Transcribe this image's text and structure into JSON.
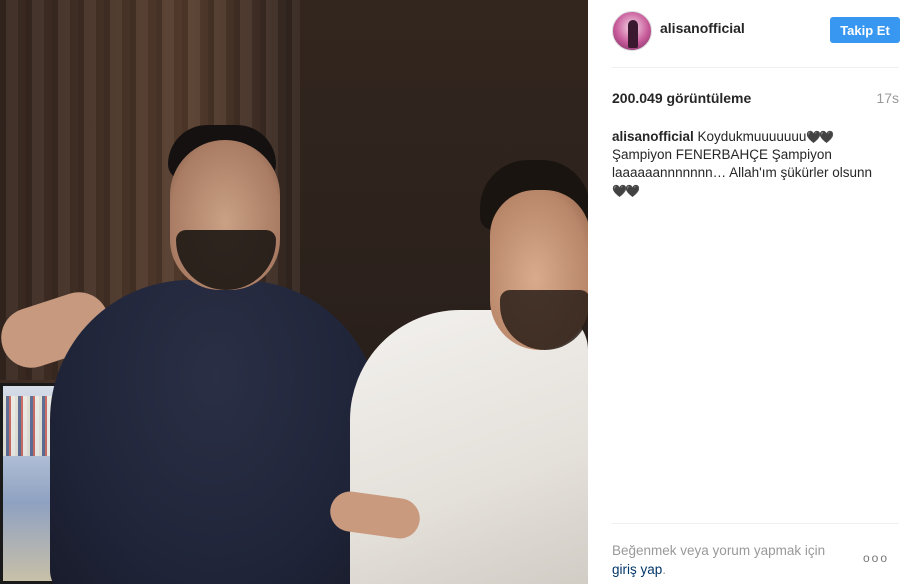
{
  "post": {
    "username": "alisanofficial",
    "follow_label": "Takip Et",
    "views": "200.049 görüntüleme",
    "time_ago": "17s",
    "caption_username": "alisanofficial",
    "caption_text": "Koydukmuuuuuuu",
    "caption_hearts_1": "🖤🖤",
    "caption_line2": "Şampiyon FENERBAHÇE Şampiyon laaaaaannnnnnn… Allah'ım şükürler olsunn",
    "caption_hearts_2": "🖤🖤",
    "footer_prefix": "Beğenmek veya yorum yapmak için",
    "login_label": "giriş yap",
    "footer_suffix": ".",
    "more_label": "ooo"
  },
  "icons": {
    "avatar": "avatar-image",
    "more": "more-options-icon"
  },
  "colors": {
    "follow_button": "#3897f0",
    "login_link": "#003569",
    "muted_text": "#999999"
  }
}
